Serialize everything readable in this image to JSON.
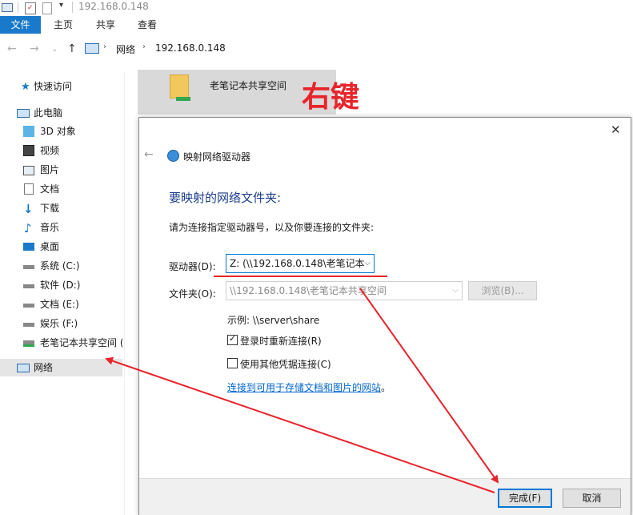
{
  "window": {
    "title": "192.168.0.148"
  },
  "ribbon": {
    "tabs": [
      "文件",
      "主页",
      "共享",
      "查看"
    ]
  },
  "address": {
    "segments": [
      "网络",
      "192.168.0.148"
    ]
  },
  "sidebar": {
    "items": [
      {
        "label": "快速访问"
      },
      {
        "label": "此电脑"
      },
      {
        "label": "3D 对象"
      },
      {
        "label": "视频"
      },
      {
        "label": "图片"
      },
      {
        "label": "文档"
      },
      {
        "label": "下载"
      },
      {
        "label": "音乐"
      },
      {
        "label": "桌面"
      },
      {
        "label": "系统 (C:)"
      },
      {
        "label": "软件 (D:)"
      },
      {
        "label": "文档 (E:)"
      },
      {
        "label": "娱乐 (F:)"
      },
      {
        "label": "老笔记本共享空间 ("
      },
      {
        "label": "网络"
      }
    ]
  },
  "content": {
    "share_name": "老笔记本共享空间",
    "annotation": "右键"
  },
  "dialog": {
    "title": "映射网络驱动器",
    "heading": "要映射的网络文件夹:",
    "instruction": "请为连接指定驱动器号，以及你要连接的文件夹:",
    "drive_label": "驱动器(D):",
    "drive_value": "Z: (\\\\192.168.0.148\\老笔记本",
    "folder_label": "文件夹(O):",
    "folder_value": "\\\\192.168.0.148\\老笔记本共享空间",
    "browse_label": "浏览(B)...",
    "example": "示例: \\\\server\\share",
    "reconnect_label": "登录时重新连接(R)",
    "reconnect_checked": true,
    "other_creds_label": "使用其他凭据连接(C)",
    "other_creds_checked": false,
    "link_text": "连接到可用于存储文档和图片的网站",
    "link_suffix": "。",
    "finish_label": "完成(F)",
    "cancel_label": "取消"
  },
  "colors": {
    "accent": "#1979ca",
    "annotation": "#e8242b",
    "heading": "#1c3e8c",
    "link": "#0066cc"
  }
}
